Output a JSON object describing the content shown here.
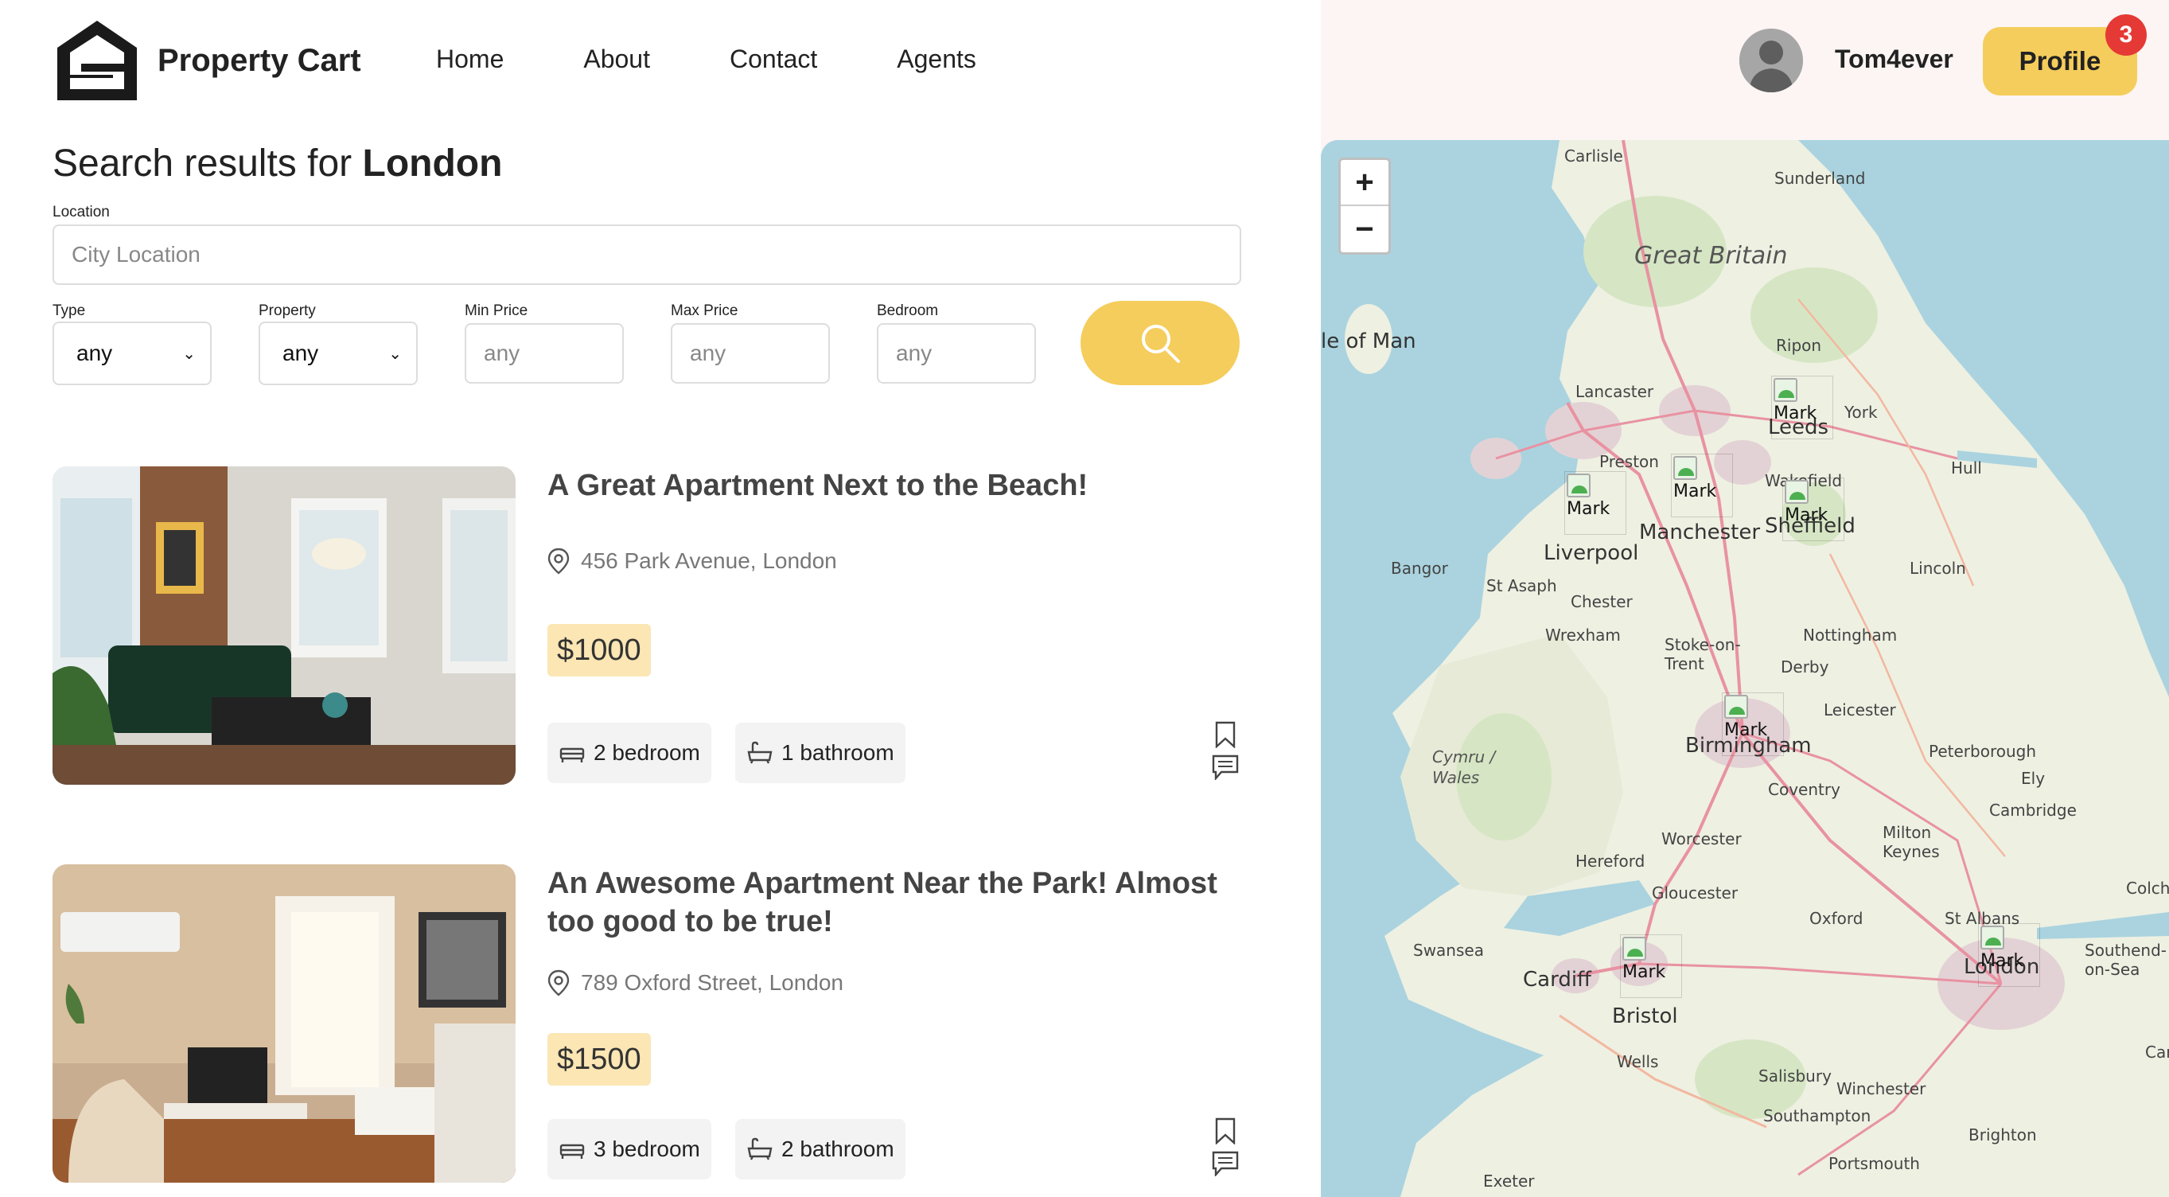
{
  "brand": {
    "name": "Property Cart"
  },
  "nav": [
    {
      "label": "Home"
    },
    {
      "label": "About"
    },
    {
      "label": "Contact"
    },
    {
      "label": "Agents"
    }
  ],
  "user": {
    "name": "Tom4ever",
    "profile_label": "Profile",
    "notifications": "3"
  },
  "search": {
    "heading_prefix": "Search results for",
    "heading_city": "London",
    "location_label": "Location",
    "location_placeholder": "City Location",
    "type_label": "Type",
    "type_value": "any",
    "property_label": "Property",
    "property_value": "any",
    "min_price_label": "Min Price",
    "min_price_placeholder": "any",
    "max_price_label": "Max Price",
    "max_price_placeholder": "any",
    "bedroom_label": "Bedroom",
    "bedroom_placeholder": "any"
  },
  "listings": [
    {
      "title": "A Great Apartment Next to the Beach!",
      "address": "456 Park Avenue, London",
      "price": "$1000",
      "bedrooms": "2 bedroom",
      "bathrooms": "1 bathroom"
    },
    {
      "title": "An Awesome Apartment Near the Park! Almost too good to be true!",
      "address": "789 Oxford Street, London",
      "price": "$1500",
      "bedrooms": "3 bedroom",
      "bathrooms": "2 bathroom"
    }
  ],
  "map": {
    "zoom_in": "+",
    "zoom_out": "−",
    "marker_label": "Mark",
    "labels": {
      "carlisle": "Carlisle",
      "sunderland": "Sunderland",
      "great_britain": "Great Britain",
      "isle_of_man": "le of Man",
      "ripon": "Ripon",
      "lancaster": "Lancaster",
      "york": "York",
      "leeds": "Leeds",
      "preston": "Preston",
      "hull": "Hull",
      "wakefield": "Wakefield",
      "manchester": "Manchester",
      "sheffield": "Sheffield",
      "liverpool": "Liverpool",
      "bangor": "Bangor",
      "lincoln": "Lincoln",
      "st_asaph": "St Asaph",
      "chester": "Chester",
      "wrexham": "Wrexham",
      "nottingham": "Nottingham",
      "stoke": "Stoke-on-\nTrent",
      "derby": "Derby",
      "leicester": "Leicester",
      "birmingham": "Birmingham",
      "peterborough": "Peterborough",
      "cymru": "Cymru /\nWales",
      "ely": "Ely",
      "coventry": "Coventry",
      "cambridge": "Cambridge",
      "worcester": "Worcester",
      "milton_keynes": "Milton\nKeynes",
      "hereford": "Hereford",
      "gloucester": "Gloucester",
      "colchester": "Colches",
      "oxford": "Oxford",
      "st_albans": "St Albans",
      "swansea": "Swansea",
      "southend": "Southend-\non-Sea",
      "cardiff": "Cardiff",
      "london": "London",
      "bristol": "Bristol",
      "wells": "Wells",
      "salisbury": "Salisbury",
      "winchester": "Winchester",
      "canterbury": "Cant",
      "southampton": "Southampton",
      "brighton": "Brighton",
      "portsmouth": "Portsmouth",
      "exeter": "Exeter"
    }
  },
  "colors": {
    "accent": "#f5cd5c",
    "price_bg": "#fbe6b4",
    "badge": "#e53935",
    "sea": "#aad3df",
    "land": "#eef0e2"
  }
}
